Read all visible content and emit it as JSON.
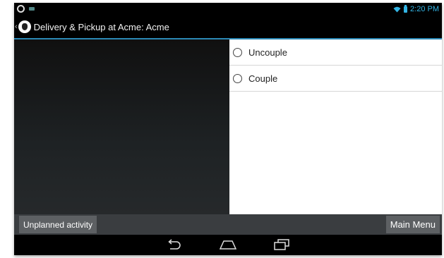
{
  "status_bar": {
    "time": "2:20 PM",
    "icons": [
      "sync-ring-icon",
      "notification-icon",
      "wifi-icon",
      "battery-icon"
    ],
    "accent_color": "#33b5e5"
  },
  "action_bar": {
    "title": "Delivery & Pickup at Acme: Acme",
    "icons": [
      "up-chevron-icon",
      "app-logo-icon"
    ]
  },
  "options": [
    {
      "label": "Uncouple",
      "selected": false
    },
    {
      "label": "Couple",
      "selected": false
    }
  ],
  "toolbar": {
    "left_button": "Unplanned activity",
    "right_button": "Main Menu"
  },
  "nav_bar": {
    "icons": [
      "back-icon",
      "home-icon",
      "recent-apps-icon"
    ]
  }
}
